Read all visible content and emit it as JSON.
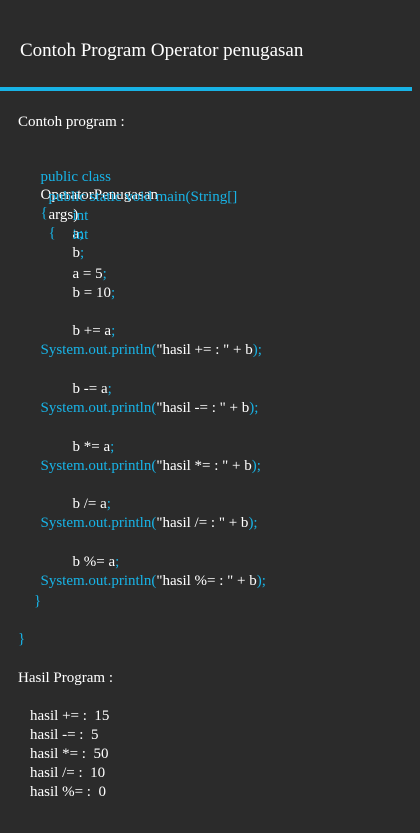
{
  "header": {
    "title": "Contoh Program Operator penugasan"
  },
  "theme": {
    "background": "#2b2b2b",
    "accent": "#18b3e6",
    "text": "#ffffff"
  },
  "content": {
    "program_label": "Contoh program :",
    "result_label": "Hasil Program :",
    "code": {
      "line1_keyword": "public class",
      "line1_name": "OperatorPenugasan",
      "line1_brace": "{",
      "line2_keyword": "public static void main(String[]",
      "line2_name": "args)",
      "line2_brace": "{",
      "line3_keyword": "int",
      "line3_name": "a",
      "line3_semicolon": ";",
      "line4_keyword": "int",
      "line4_name": "b",
      "line4_semicolon": ";",
      "line5_name": "a = 5",
      "line5_semicolon": ";",
      "line6_name": "b = 10",
      "line6_semicolon": ";",
      "line7_name": "b += a",
      "line7_semicolon": ";",
      "line8_prefix": "System.out.println(",
      "line8_string": "\"hasil += : \" + b",
      "line8_suffix": ");",
      "line9_name": "b -= a",
      "line9_semicolon": ";",
      "line10_prefix": "System.out.println(",
      "line10_string": "\"hasil -= : \" + b",
      "line10_suffix": ");",
      "line11_name": "b *= a",
      "line11_semicolon": ";",
      "line12_prefix": "System.out.println(",
      "line12_string": "\"hasil *= : \" + b",
      "line12_suffix": ");",
      "line13_name": "b /= a",
      "line13_semicolon": ";",
      "line14_prefix": "System.out.println(",
      "line14_string": "\"hasil /= : \" + b",
      "line14_suffix": ");",
      "line15_name": "b %= a",
      "line15_semicolon": ";",
      "line16_prefix": "System.out.println(",
      "line16_string": "\"hasil %= : \" + b",
      "line16_suffix": ");",
      "line17_brace": "}",
      "line18_brace": "}"
    },
    "results": [
      "hasil += :  15",
      "hasil -= :  5",
      "hasil *= :  50",
      "hasil /= :  10",
      "hasil %= :  0"
    ]
  }
}
